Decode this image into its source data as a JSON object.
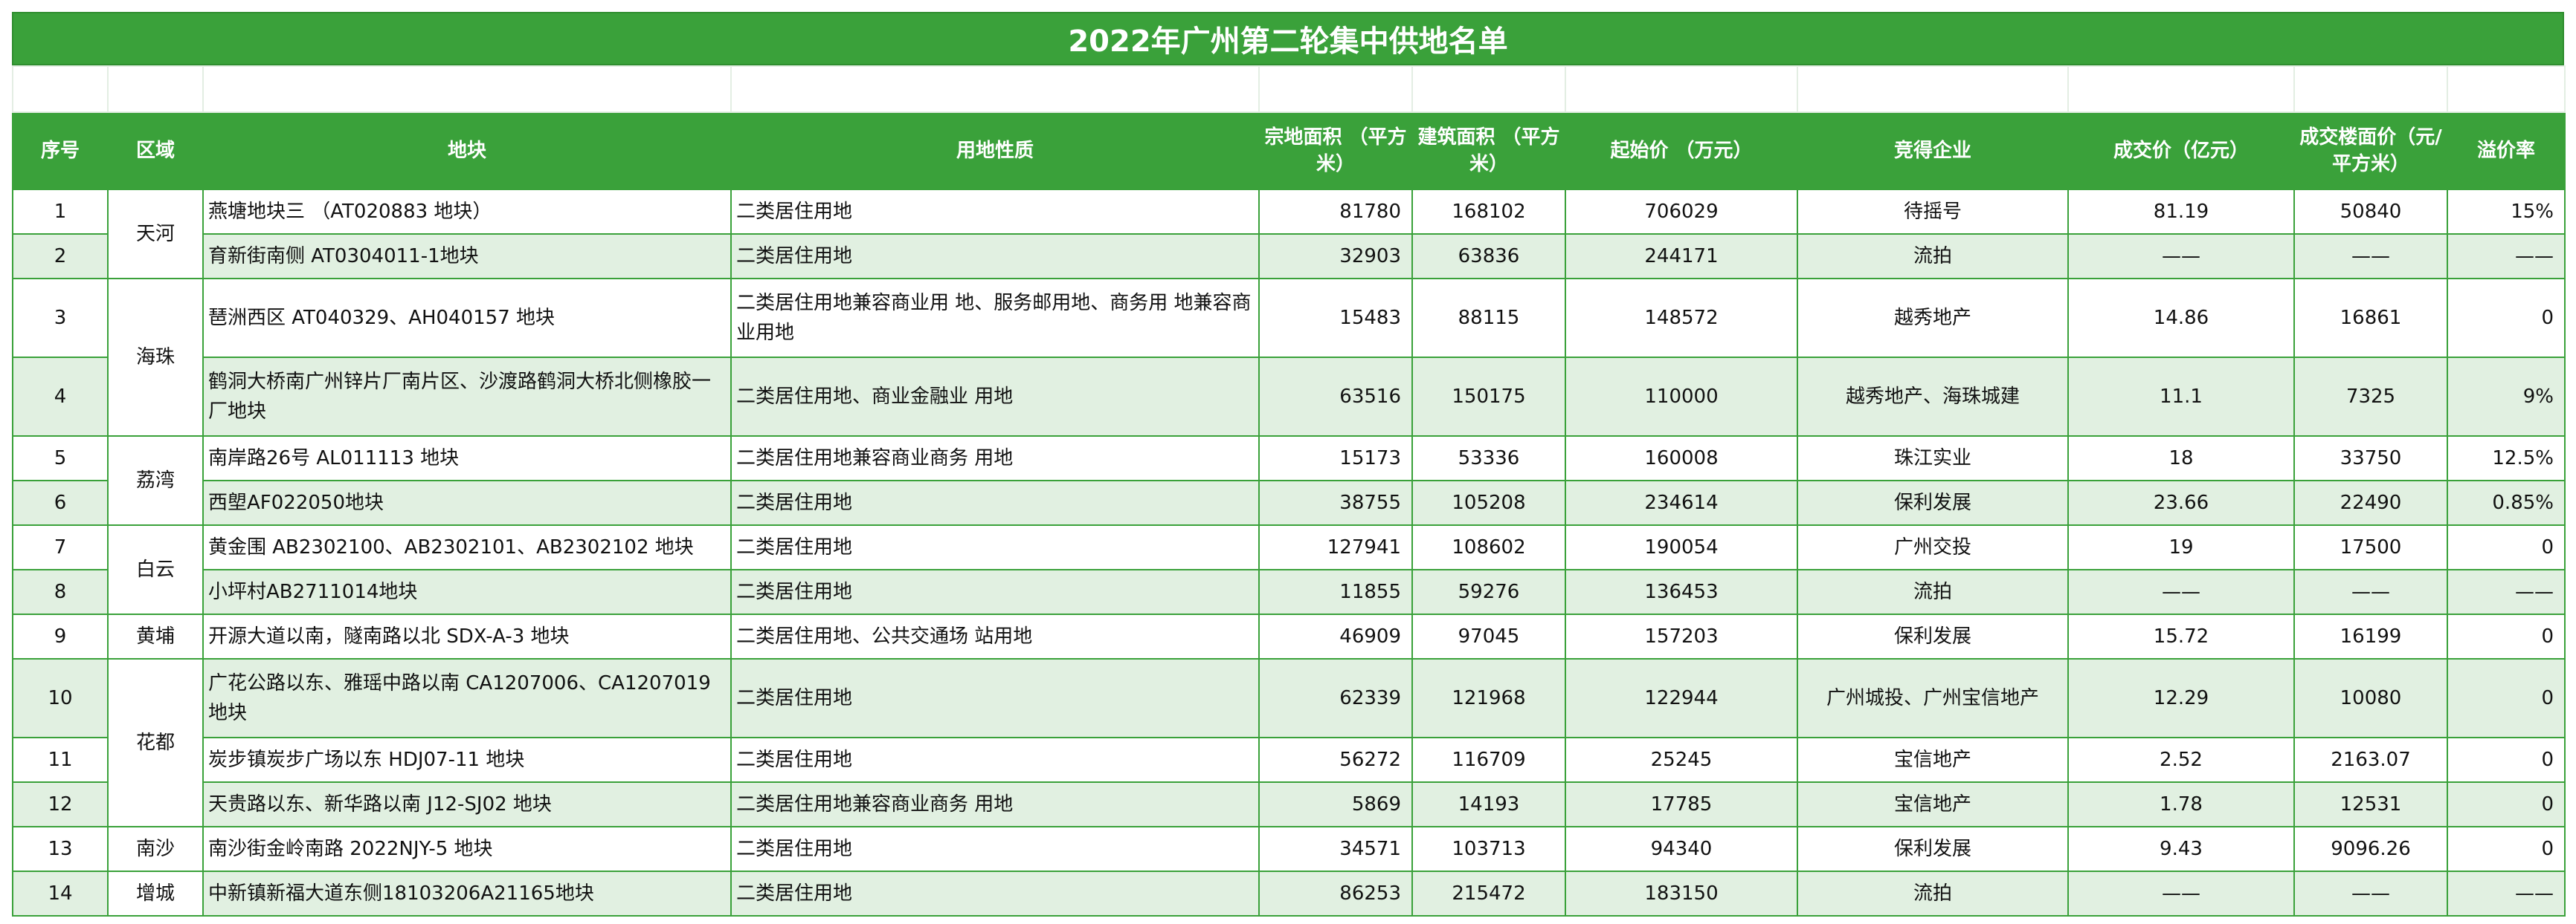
{
  "title": "2022年广州第二轮集中供地名单",
  "headers": {
    "index": "序号",
    "district": "区域",
    "parcel": "地块",
    "usage": "用地性质",
    "site_area": "宗地面积 （平方米）",
    "building_area": "建筑面积 （平方米）",
    "start_price": "起始价 （万元）",
    "winner": "竞得企业",
    "deal_price": "成交价（亿元）",
    "floor_price": "成交楼面价（元/平方米）",
    "premium": "溢价率"
  },
  "districts": [
    "天河",
    "海珠",
    "荔湾",
    "白云",
    "黄埔",
    "花都",
    "南沙",
    "增城"
  ],
  "rows": [
    {
      "index": "1",
      "parcel": "燕塘地块三 （AT020883 地块）",
      "usage": "二类居住用地",
      "site_area": "81780",
      "building_area": "168102",
      "start_price": "706029",
      "winner": "待摇号",
      "deal_price": "81.19",
      "floor_price": "50840",
      "premium": "15%"
    },
    {
      "index": "2",
      "parcel": "育新街南侧 AT0304011-1地块",
      "usage": "二类居住用地",
      "site_area": "32903",
      "building_area": "63836",
      "start_price": "244171",
      "winner": "流拍",
      "deal_price": "——",
      "floor_price": "——",
      "premium": "——"
    },
    {
      "index": "3",
      "parcel": "琶洲西区 AT040329、AH040157 地块",
      "usage": "二类居住用地兼容商业用 地、服务邮用地、商务用 地兼容商业用地",
      "site_area": "15483",
      "building_area": "88115",
      "start_price": "148572",
      "winner": "越秀地产",
      "deal_price": "14.86",
      "floor_price": "16861",
      "premium": "0"
    },
    {
      "index": "4",
      "parcel": "鹤洞大桥南广州锌片厂南片区、沙渡路鹤洞大桥北侧橡胶一厂地块",
      "usage": "二类居住用地、商业金融业 用地",
      "site_area": "63516",
      "building_area": "150175",
      "start_price": "110000",
      "winner": "越秀地产、海珠城建",
      "deal_price": "11.1",
      "floor_price": "7325",
      "premium": "9%"
    },
    {
      "index": "5",
      "parcel": "南岸路26号 AL011113 地块",
      "usage": "二类居住用地兼容商业商务 用地",
      "site_area": "15173",
      "building_area": "53336",
      "start_price": "160008",
      "winner": "珠江实业",
      "deal_price": "18",
      "floor_price": "33750",
      "premium": "12.5%"
    },
    {
      "index": "6",
      "parcel": "西塱AF022050地块",
      "usage": "二类居住用地",
      "site_area": "38755",
      "building_area": "105208",
      "start_price": "234614",
      "winner": "保利发展",
      "deal_price": "23.66",
      "floor_price": "22490",
      "premium": "0.85%"
    },
    {
      "index": "7",
      "parcel": "黄金围 AB2302100、AB2302101、AB2302102 地块",
      "usage": "二类居住用地",
      "site_area": "127941",
      "building_area": "108602",
      "start_price": "190054",
      "winner": "广州交投",
      "deal_price": "19",
      "floor_price": "17500",
      "premium": "0"
    },
    {
      "index": "8",
      "parcel": "小坪村AB2711014地块",
      "usage": "二类居住用地",
      "site_area": "11855",
      "building_area": "59276",
      "start_price": "136453",
      "winner": "流拍",
      "deal_price": "——",
      "floor_price": "——",
      "premium": "——"
    },
    {
      "index": "9",
      "parcel": "开源大道以南，隧南路以北 SDX-A-3 地块",
      "usage": "二类居住用地、公共交通场 站用地",
      "site_area": "46909",
      "building_area": "97045",
      "start_price": "157203",
      "winner": "保利发展",
      "deal_price": "15.72",
      "floor_price": "16199",
      "premium": "0"
    },
    {
      "index": "10",
      "parcel": "广花公路以东、雅瑶中路以南 CA1207006、CA1207019 地块",
      "usage": "二类居住用地",
      "site_area": "62339",
      "building_area": "121968",
      "start_price": "122944",
      "winner": "广州城投、广州宝信地产",
      "deal_price": "12.29",
      "floor_price": "10080",
      "premium": "0"
    },
    {
      "index": "11",
      "parcel": "炭步镇炭步广场以东 HDJ07-11 地块",
      "usage": "二类居住用地",
      "site_area": "56272",
      "building_area": "116709",
      "start_price": "25245",
      "winner": "宝信地产",
      "deal_price": "2.52",
      "floor_price": "2163.07",
      "premium": "0"
    },
    {
      "index": "12",
      "parcel": "天贵路以东、新华路以南 J12-SJ02 地块",
      "usage": "二类居住用地兼容商业商务 用地",
      "site_area": "5869",
      "building_area": "14193",
      "start_price": "17785",
      "winner": "宝信地产",
      "deal_price": "1.78",
      "floor_price": "12531",
      "premium": "0"
    },
    {
      "index": "13",
      "parcel": "南沙街金岭南路 2022NJY-5 地块",
      "usage": "二类居住用地",
      "site_area": "34571",
      "building_area": "103713",
      "start_price": "94340",
      "winner": "保利发展",
      "deal_price": "9.43",
      "floor_price": "9096.26",
      "premium": "0"
    },
    {
      "index": "14",
      "parcel": "中新镇新福大道东侧18103206A21165地块",
      "usage": "二类居住用地",
      "site_area": "86253",
      "building_area": "215472",
      "start_price": "183150",
      "winner": "流拍",
      "deal_price": "——",
      "floor_price": "——",
      "premium": "——"
    }
  ]
}
